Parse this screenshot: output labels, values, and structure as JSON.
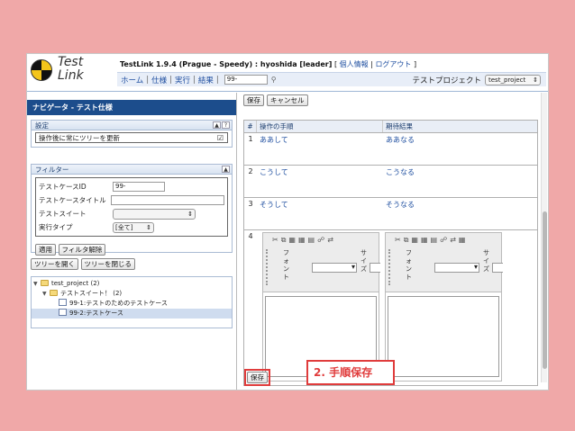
{
  "header": {
    "logo_line1": "Test",
    "logo_line2": "Link",
    "app_title": "TestLink 1.9.4 (Prague - Speedy) : hyoshida [leader]",
    "bracket_open": "[",
    "personal_info": "個人情報",
    "divider": "|",
    "logout": "ログアウト",
    "bracket_close": "]"
  },
  "navbar": {
    "home": "ホーム",
    "spec": "仕様",
    "execute": "実行",
    "results": "結果",
    "sep": "|",
    "tc_search_value": "99-",
    "project_label": "テストプロジェクト",
    "project_value": "test_project"
  },
  "left": {
    "title": "ナビゲータ - テスト仕様",
    "settings_head": "設定",
    "settings_btn_collapse": "▲",
    "settings_btn_help": "?",
    "settings_option": "操作後に常にツリーを更新",
    "settings_check": "☑",
    "filter_head": "フィルター",
    "filter_btn_collapse": "▲",
    "filter": {
      "tc_id_label": "テストケースID",
      "tc_id_value": "99-",
      "tc_title_label": "テストケースタイトル",
      "tc_title_value": "",
      "suite_label": "テストスイート",
      "suite_value": "",
      "exec_type_label": "実行タイプ",
      "exec_type_value": "[全て]"
    },
    "apply_btn": "適用",
    "reset_btn": "フィルタ解除",
    "expand_btn": "ツリーを開く",
    "collapse_btn": "ツリーを閉じる",
    "tree": [
      {
        "label": "test_project (2)"
      },
      {
        "label": "テストスイート！ (2)"
      },
      {
        "label": "99-1:テストのためのテストケース"
      },
      {
        "label": "99-2:テストケース"
      }
    ]
  },
  "right": {
    "save_btn": "保存",
    "cancel_btn": "キャンセル",
    "col_num": "#",
    "col_action": "操作の手順",
    "col_expected": "期待結果",
    "steps": [
      {
        "num": "1",
        "action": "ああして",
        "expected": "ああなる"
      },
      {
        "num": "2",
        "action": "こうして",
        "expected": "こうなる"
      },
      {
        "num": "3",
        "action": "そうして",
        "expected": "そうなる"
      }
    ],
    "new_step_num": "4",
    "editor_font_label": "フォント",
    "editor_size_label": "サイズ",
    "bottom_save_btn": "保存",
    "annotation": "2. 手順保存"
  },
  "colors": {
    "background": "#f0a8a8",
    "nav_title": "#1c4d8c",
    "link": "#1f4fa0",
    "highlight": "#e03c3c"
  }
}
